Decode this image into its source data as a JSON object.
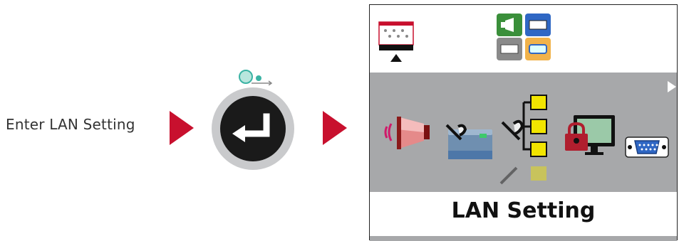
{
  "instruction": {
    "text": "Enter LAN Setting"
  },
  "panel": {
    "menu_title": "LAN Setting",
    "top_icons": [
      "printer-status-icon",
      "interface-group-icon"
    ],
    "menu_icons": [
      "beacon-icon",
      "printer-tool-icon",
      "network-tool-icon",
      "lock-screen-icon",
      "serial-port-icon"
    ],
    "page_arrow": "right-triangle-icon"
  },
  "colors": {
    "accent_red": "#c8102e",
    "band_gray": "#a7a8aa",
    "lcd_border": "#222222",
    "network_yellow": "#f2e500",
    "teal_dots": "#3bb3a4"
  }
}
